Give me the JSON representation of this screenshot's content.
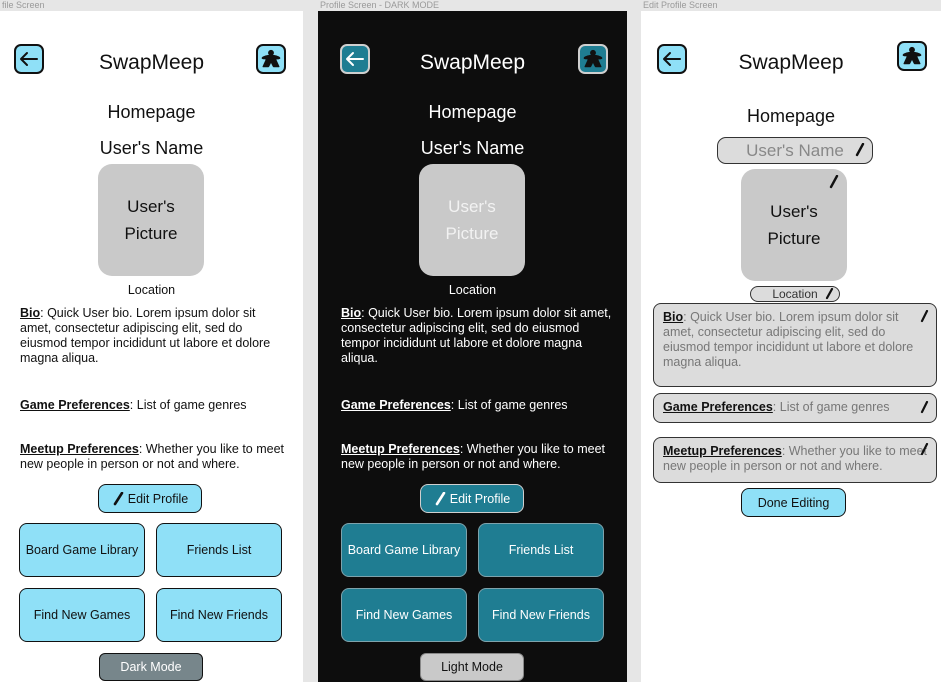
{
  "frames": {
    "profile_label": "file Screen",
    "dark_label": "Profile Screen - DARK MODE",
    "edit_label": "Edit Profile Screen"
  },
  "app": {
    "title": "SwapMeep",
    "page": "Homepage",
    "user_name": "User's Name",
    "picture_line1": "User's",
    "picture_line2": "Picture",
    "location": "Location"
  },
  "profile": {
    "bio_label": "Bio",
    "bio_text": ": Quick User bio. Lorem ipsum dolor sit amet, consectetur adipiscing elit, sed do eiusmod tempor incididunt ut labore et dolore magna aliqua.",
    "game_label": "Game Preferences",
    "game_text": ": List of game genres",
    "meetup_label": "Meetup Preferences",
    "meetup_text": ": Whether you like to meet new people in person or not and where."
  },
  "buttons": {
    "edit_profile": "Edit Profile",
    "board_game_library": "Board Game Library",
    "friends_list": "Friends List",
    "find_new_games": "Find New Games",
    "find_new_friends": "Find New Friends",
    "dark_mode": "Dark Mode",
    "light_mode": "Light Mode",
    "done_editing": "Done Editing"
  },
  "icons": {
    "back": "arrow-left-icon",
    "meeple": "meeple-icon",
    "pencil": "pencil-icon"
  },
  "colors": {
    "accent": "#8fe0f7",
    "accent_dark": "#1f7d92",
    "dark_bg": "#0d0d0d",
    "picture_bg": "#c9c9c9",
    "dark_mode_btn": "#77868b",
    "light_mode_btn": "#c9c9c9"
  }
}
